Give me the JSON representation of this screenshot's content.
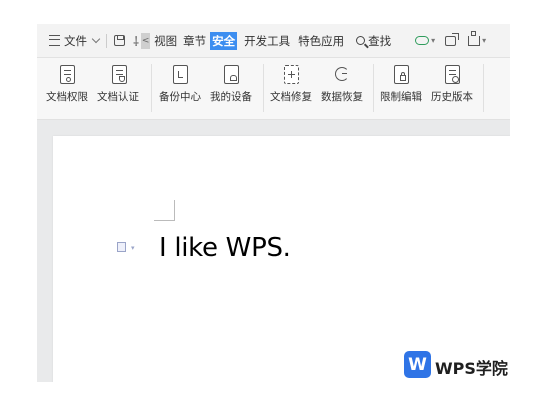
{
  "menubar": {
    "file_label": "文件",
    "tabs": [
      "视图",
      "章节",
      "安全",
      "开发工具",
      "特色应用"
    ],
    "tab_prefix": "<",
    "active_tab": "安全",
    "search_label": "查找"
  },
  "ribbon": {
    "buttons": [
      {
        "label": "文档权限",
        "icon": "doc-permission-icon"
      },
      {
        "label": "文档认证",
        "icon": "doc-certify-icon"
      },
      {
        "label": "备份中心",
        "icon": "backup-center-icon"
      },
      {
        "label": "我的设备",
        "icon": "my-device-icon"
      },
      {
        "label": "文档修复",
        "icon": "doc-repair-icon"
      },
      {
        "label": "数据恢复",
        "icon": "data-recovery-icon"
      },
      {
        "label": "限制编辑",
        "icon": "restrict-edit-icon"
      },
      {
        "label": "历史版本",
        "icon": "history-version-icon"
      }
    ]
  },
  "document": {
    "text": "I like WPS."
  },
  "watermark": {
    "logo_letter": "W",
    "text": "WPS学院"
  },
  "colors": {
    "accent": "#3d8ef0",
    "logo": "#2f74e6",
    "cloud": "#2f9c5c"
  }
}
